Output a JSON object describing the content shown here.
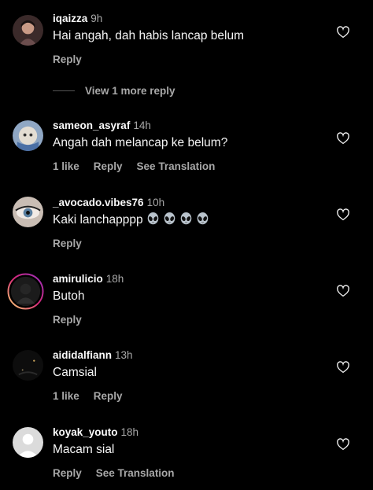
{
  "comments": [
    {
      "username": "iqaizza",
      "time": "9h",
      "text": "Hai angah, dah habis lancap belum",
      "actions": [
        "Reply"
      ],
      "view_more": "View 1 more reply"
    },
    {
      "username": "sameon_asyraf",
      "time": "14h",
      "text": "Angah dah melancap ke belum?",
      "actions": [
        "1 like",
        "Reply",
        "See Translation"
      ]
    },
    {
      "username": "_avocado.vibes76",
      "time": "10h",
      "text": "Kaki lanchapppp",
      "emojis": [
        "alien-emoji",
        "alien-emoji",
        "alien-emoji",
        "alien-emoji"
      ],
      "actions": [
        "Reply"
      ]
    },
    {
      "username": "amirulicio",
      "time": "18h",
      "text": "Butoh",
      "actions": [
        "Reply"
      ]
    },
    {
      "username": "aididalfiann",
      "time": "13h",
      "text": "Camsial",
      "actions": [
        "1 like",
        "Reply"
      ]
    },
    {
      "username": "koyak_youto",
      "time": "18h",
      "text": "Macam sial",
      "actions": [
        "Reply",
        "See Translation"
      ]
    }
  ],
  "icons": {
    "like": "heart-outline-icon"
  },
  "colors": {
    "background": "#000000",
    "primary_text": "#f5f5f5",
    "secondary_text": "#a8a8a8",
    "story_ring": "#d62976"
  }
}
